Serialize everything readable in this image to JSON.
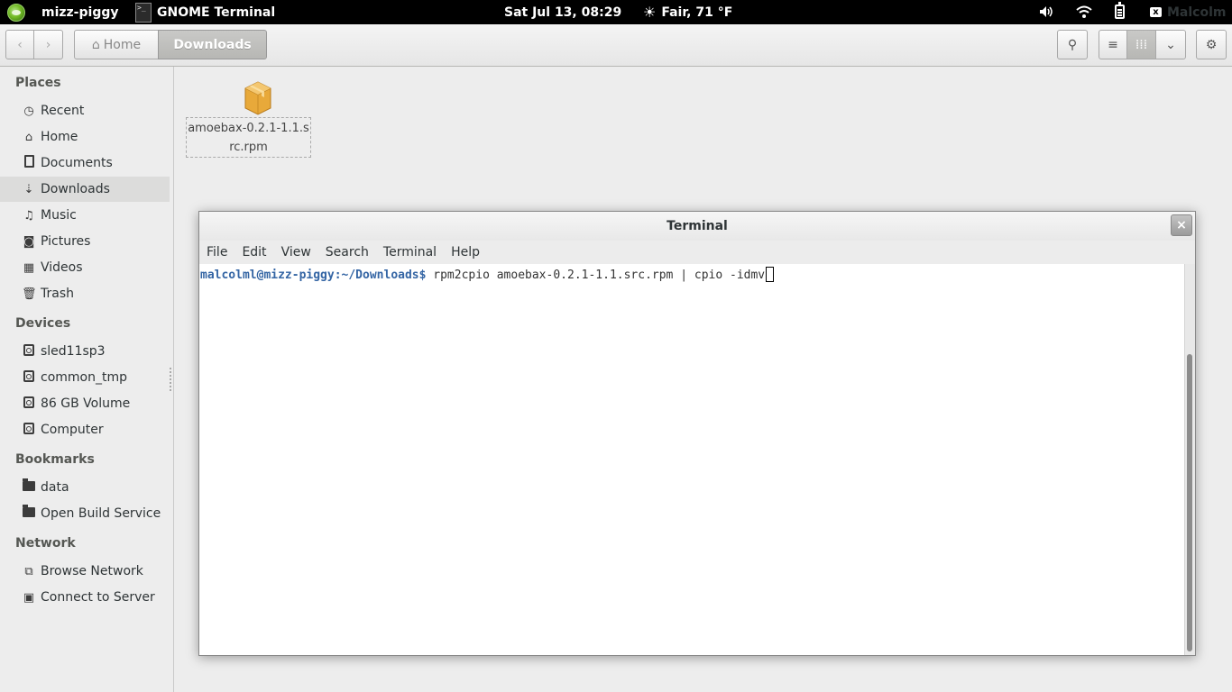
{
  "top_panel": {
    "activities_label": "mizz-piggy",
    "app_menu_icon_text": ">_",
    "app_menu_label": "GNOME Terminal",
    "clock": "Sat Jul 13, 08:29",
    "weather": "Fair, 71 °F",
    "weather_icon": "sun-icon",
    "user_name": "Malcolm",
    "user_status_icon_text": "x"
  },
  "toolbar": {
    "back_icon": "‹",
    "forward_icon": "›",
    "home_icon": "⌂",
    "breadcrumb_home": "Home",
    "breadcrumb_current": "Downloads",
    "search_icon": "⚲",
    "list_view_icon": "≡",
    "grid_view_icon": "⁞⁞⁞",
    "view_menu_icon": "⌄",
    "settings_icon": "⚙"
  },
  "sidebar": {
    "places_heading": "Places",
    "places": [
      {
        "label": "Recent",
        "icon": "◷"
      },
      {
        "label": "Home",
        "icon": "⌂"
      },
      {
        "label": "Documents",
        "icon": "doc"
      },
      {
        "label": "Downloads",
        "icon": "⇣"
      },
      {
        "label": "Music",
        "icon": "♫"
      },
      {
        "label": "Pictures",
        "icon": "◙"
      },
      {
        "label": "Videos",
        "icon": "▦"
      },
      {
        "label": "Trash",
        "icon": "🗑"
      }
    ],
    "devices_heading": "Devices",
    "devices": [
      {
        "label": "sled11sp3"
      },
      {
        "label": "common_tmp"
      },
      {
        "label": "86 GB Volume"
      },
      {
        "label": "Computer"
      }
    ],
    "bookmarks_heading": "Bookmarks",
    "bookmarks": [
      {
        "label": "data"
      },
      {
        "label": "Open Build Service"
      }
    ],
    "network_heading": "Network",
    "network": [
      {
        "label": "Browse Network",
        "icon": "⧉"
      },
      {
        "label": "Connect to Server",
        "icon": "▣"
      }
    ]
  },
  "content": {
    "file_name": "amoebax-0.2.1-1.1.src.rpm"
  },
  "terminal": {
    "title": "Terminal",
    "close_icon": "×",
    "menu": [
      "File",
      "Edit",
      "View",
      "Search",
      "Terminal",
      "Help"
    ],
    "prompt": "malcolml@mizz-piggy:~/Downloads$",
    "command": " rpm2cpio amoebax-0.2.1-1.1.src.rpm | cpio -idmv"
  }
}
